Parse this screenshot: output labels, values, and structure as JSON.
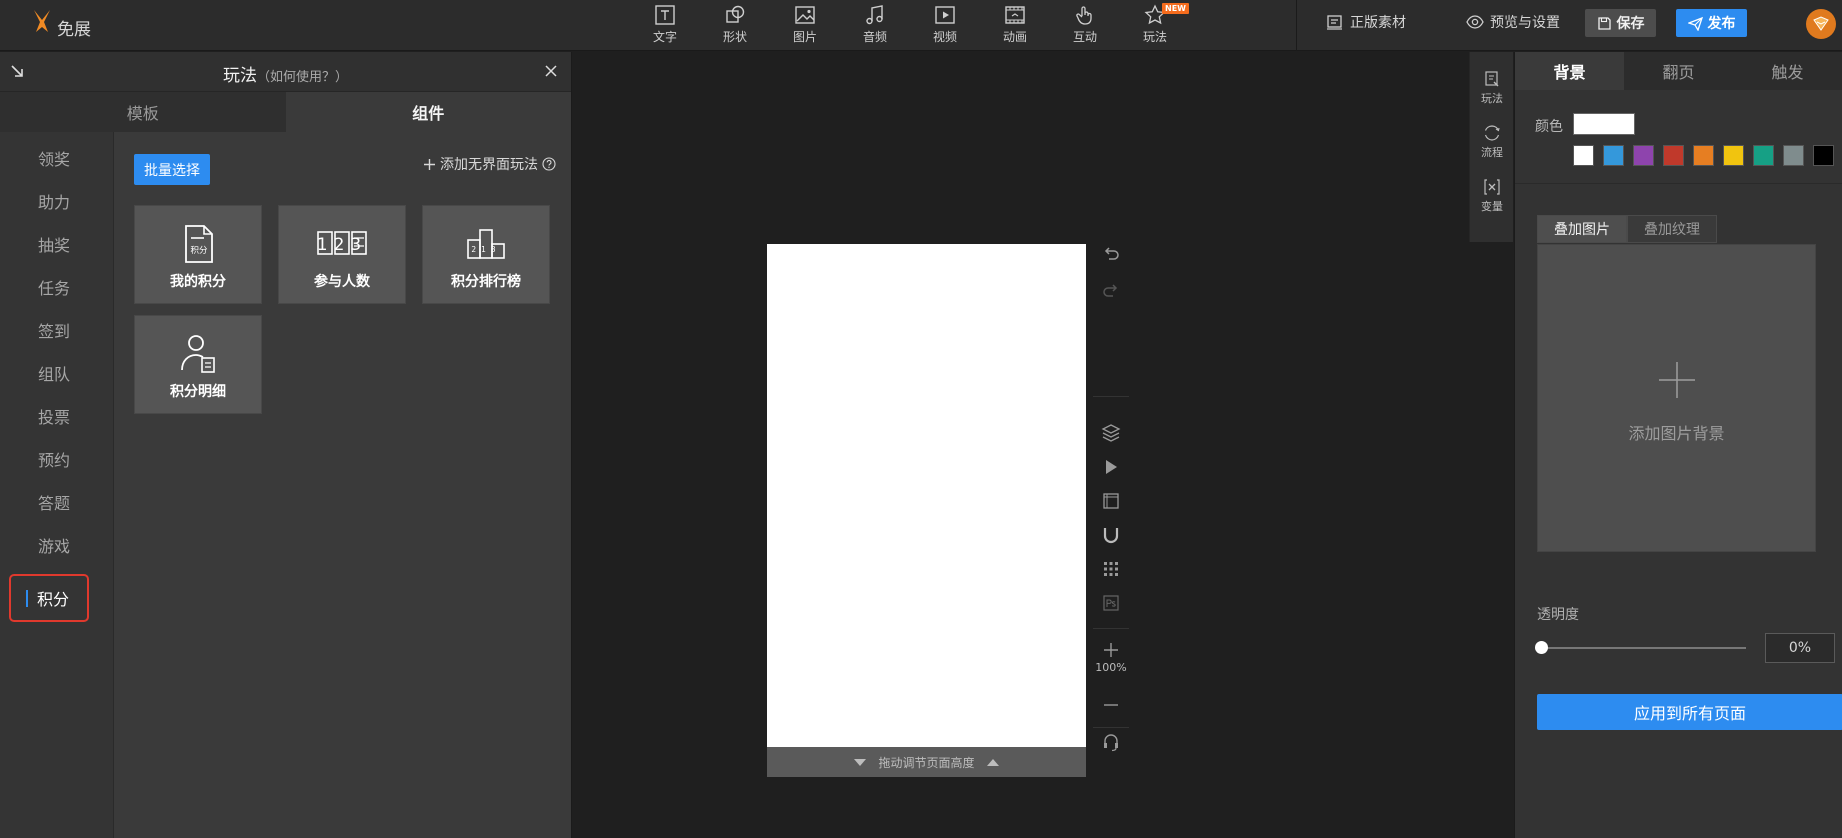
{
  "app": {
    "logo_text": "免展"
  },
  "toolbar": {
    "tools": [
      {
        "label": "文字",
        "icon": "text-icon"
      },
      {
        "label": "形状",
        "icon": "shape-icon"
      },
      {
        "label": "图片",
        "icon": "image-icon"
      },
      {
        "label": "音频",
        "icon": "music-icon"
      },
      {
        "label": "视频",
        "icon": "video-icon"
      },
      {
        "label": "动画",
        "icon": "animation-icon"
      },
      {
        "label": "互动",
        "icon": "hand-icon"
      },
      {
        "label": "玩法",
        "icon": "star-icon",
        "badge": "NEW"
      }
    ],
    "materials_label": "正版素材",
    "preview_label": "预览与设置",
    "save_label": "保存",
    "publish_label": "发布"
  },
  "left_panel": {
    "title": "玩法",
    "help_text": "（如何使用？）",
    "tabs": [
      {
        "label": "模板",
        "active": false
      },
      {
        "label": "组件",
        "active": true
      }
    ],
    "categories": [
      "领奖",
      "助力",
      "抽奖",
      "任务",
      "签到",
      "组队",
      "投票",
      "预约",
      "答题",
      "游戏",
      "积分"
    ],
    "selected_category": "积分",
    "batch_select_label": "批量选择",
    "add_link_label": "添加无界面玩法",
    "cards": [
      {
        "label": "我的积分",
        "icon": "points-document-icon",
        "icon_text": "积分"
      },
      {
        "label": "参与人数",
        "icon": "counter-digits-icon",
        "icon_text": "123"
      },
      {
        "label": "积分排行榜",
        "icon": "podium-icon",
        "icon_text": "213"
      },
      {
        "label": "积分明细",
        "icon": "user-detail-icon"
      }
    ]
  },
  "canvas": {
    "height_bar_label": "拖动调节页面高度",
    "zoom_level": "100%"
  },
  "mini_panel": {
    "items": [
      {
        "label": "玩法",
        "icon": "gameplay-icon"
      },
      {
        "label": "流程",
        "icon": "flow-icon"
      },
      {
        "label": "变量",
        "icon": "variable-icon"
      }
    ]
  },
  "right_panel": {
    "tabs": [
      {
        "label": "背景",
        "active": true
      },
      {
        "label": "翻页",
        "active": false
      },
      {
        "label": "触发",
        "active": false
      }
    ],
    "color_label": "颜色",
    "current_color": "#ffffff",
    "swatches": [
      "#ffffff",
      "#3498db",
      "#8e44ad",
      "#c0392b",
      "#e67e22",
      "#f1c40f",
      "#16a085",
      "#7f8c8d",
      "#000000"
    ],
    "sub_tabs": [
      {
        "label": "叠加图片",
        "active": true
      },
      {
        "label": "叠加纹理",
        "active": false
      }
    ],
    "add_bg_label": "添加图片背景",
    "opacity_label": "透明度",
    "opacity_value": "0%",
    "opacity_fraction": 0,
    "apply_label": "应用到所有页面"
  },
  "colors": {
    "accent": "#2d8cf0",
    "highlight_border": "#e0392d",
    "new_badge": "#f56c1d"
  }
}
